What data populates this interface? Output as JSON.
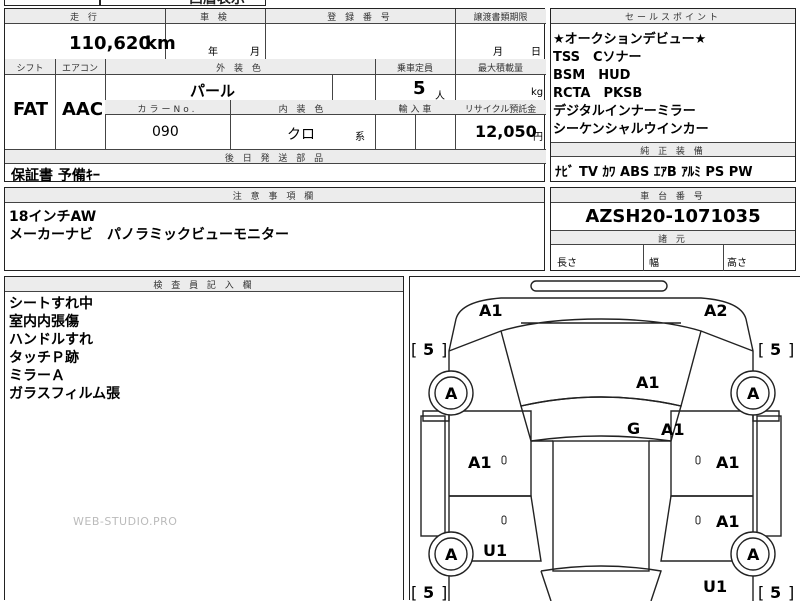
{
  "top_partial": "西暦表示",
  "mileage": {
    "header": "走 行",
    "value": "110,620",
    "unit": "km"
  },
  "inspection": {
    "header": "車 検",
    "year_label": "年",
    "month_label": "月"
  },
  "registration": {
    "header": "登 録 番 号"
  },
  "transfer_deadline": {
    "header": "譲渡書類期限",
    "month_label": "月",
    "day_label": "日"
  },
  "sales_points": {
    "header": "セールスポイント",
    "lines": [
      "★オークションデビュー★",
      "TSS　Cソナー",
      "BSM　HUD",
      "RCTA　PKSB",
      "デジタルインナーミラー",
      "シーケンシャルウインカー"
    ]
  },
  "shift": {
    "header": "シフト",
    "value": "FAT"
  },
  "aircon": {
    "header": "エアコン",
    "value": "AAC"
  },
  "exterior_color": {
    "header": "外 装 色",
    "value": "パール"
  },
  "capacity": {
    "header": "乗車定員",
    "value": "5",
    "unit": "人"
  },
  "max_load": {
    "header": "最大積載量",
    "unit": "kg"
  },
  "color_no": {
    "header": "カラーNo.",
    "value": "090"
  },
  "interior_color": {
    "header": "内 装 色",
    "value": "クロ",
    "suffix": "系"
  },
  "import": {
    "header": "輸 入 車"
  },
  "recycle": {
    "header": "リサイクル預託金",
    "value": "12,050",
    "unit": "円"
  },
  "deferred_parts": {
    "header": "後 日 発 送 部 品",
    "value": "保証書 予備ｷｰ"
  },
  "genuine_equipment": {
    "header": "純 正 装 備",
    "value": "ﾅﾋﾞ TV ｶﾜ ABS ｴｱB ｱﾙﾐ PS PW"
  },
  "notes": {
    "header": "注 意 事 項 欄",
    "lines": [
      "18インチAW",
      "メーカーナビ　パノラミックビューモニター"
    ]
  },
  "chassis": {
    "header": "車 台 番 号",
    "value": "AZSH20-1071035"
  },
  "dimensions": {
    "header": "諸 元",
    "length": "長さ",
    "width": "幅",
    "height": "高さ"
  },
  "inspector": {
    "header": "検 査 員 記 入 欄",
    "lines": [
      "シートすれ中",
      "室内内張傷",
      "ハンドルすれ",
      "タッチＰ跡",
      "ミラーＡ",
      "ガラスフィルム張"
    ]
  },
  "watermark": "WEB-STUDIO.PRO",
  "diagram": {
    "tire": "A",
    "tire_grade": "5",
    "bracket_left": "[",
    "bracket_right": "]",
    "marks": {
      "front_left_corner": "A1",
      "front_right_corner": "A2",
      "hood": "A1",
      "windshield": "G",
      "windshield_right": "A1",
      "left_front_door": "A1",
      "right_front_door": "A1",
      "right_rear_door": "A1",
      "left_rear_fender": "U1",
      "right_rear_bottom": "U1"
    },
    "door_small": "0"
  }
}
